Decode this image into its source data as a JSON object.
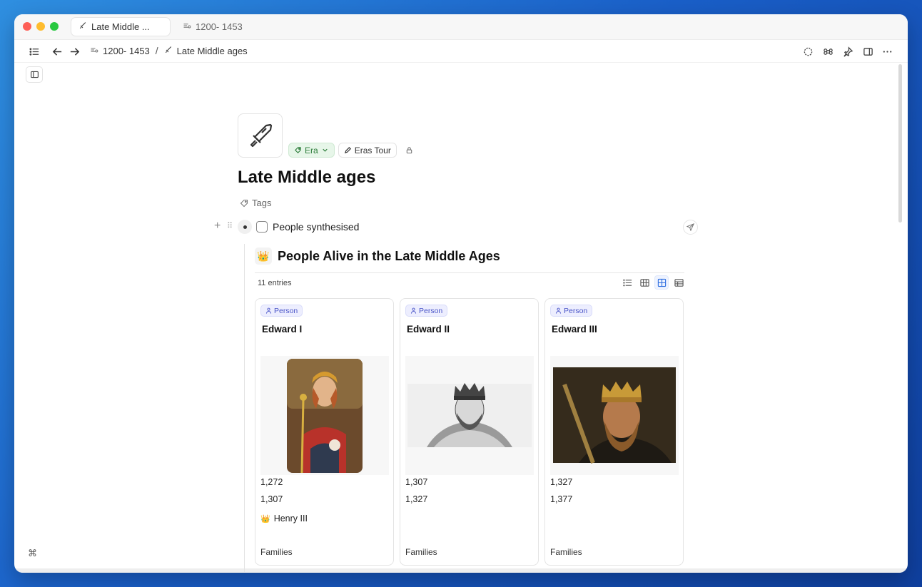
{
  "tabs": [
    {
      "label": "Late Middle ..."
    },
    {
      "label": "1200- 1453"
    }
  ],
  "breadcrumb": {
    "parent": "1200- 1453",
    "separator": "/",
    "current": "Late Middle ages"
  },
  "page": {
    "title": "Late Middle ages",
    "type_chip": "Era",
    "tag_chip": "Eras Tour",
    "tags_label": "Tags"
  },
  "block": {
    "text": "People synthesised"
  },
  "database": {
    "emoji": "👑",
    "title": "People Alive in the Late Middle Ages",
    "count": "11 entries",
    "cards": [
      {
        "badge": "Person",
        "name": "Edward I",
        "born": "1,272",
        "died": "1,307",
        "relation_emoji": "👑",
        "relation": "Henry III",
        "footer": "Families"
      },
      {
        "badge": "Person",
        "name": "Edward II",
        "born": "1,307",
        "died": "1,327",
        "relation_emoji": "",
        "relation": "",
        "footer": "Families"
      },
      {
        "badge": "Person",
        "name": "Edward III",
        "born": "1,327",
        "died": "1,377",
        "relation_emoji": "",
        "relation": "",
        "footer": "Families"
      }
    ]
  },
  "colors": {
    "accent_blue": "#2f6fe0",
    "era_green": "#2e7d3b",
    "person_badge": "#4a55c8"
  }
}
